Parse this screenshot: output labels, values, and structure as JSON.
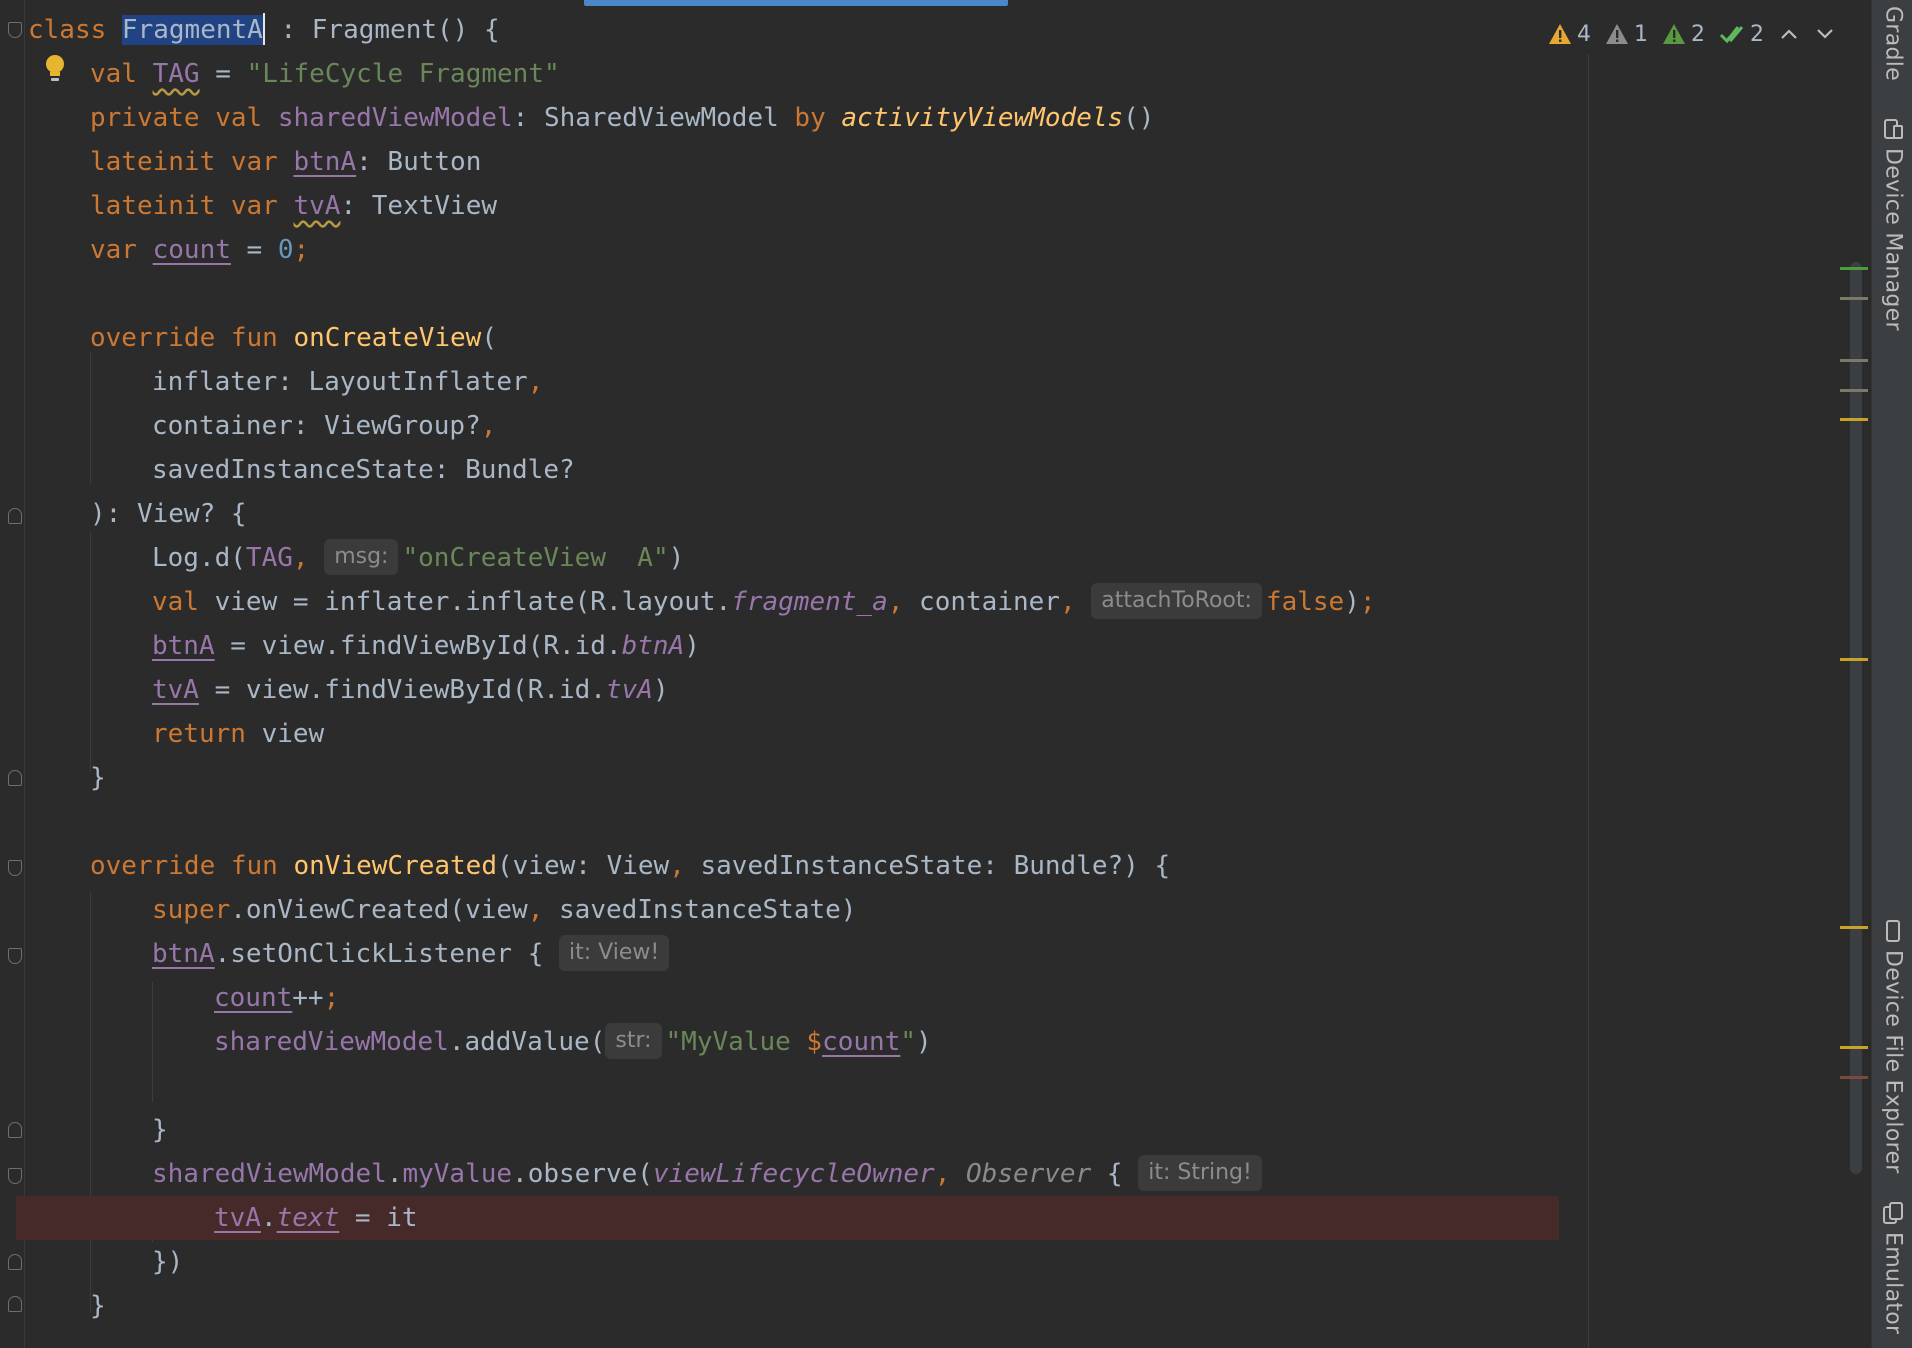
{
  "inspections": {
    "warnings": "4",
    "weak_warnings": "1",
    "typos": "2",
    "ok": "2",
    "colors": {
      "warning": "#e5a834",
      "weak": "#8c8c8c",
      "typo": "#5a9a3e",
      "ok": "#5fb85f"
    }
  },
  "code_lines": [
    [
      {
        "t": "class ",
        "c": "kw"
      },
      {
        "t": "FragmentA",
        "c": "selected"
      },
      {
        "caret": true
      },
      {
        "t": " : Fragment() {",
        "c": "plain"
      }
    ],
    [
      {
        "t": "val ",
        "c": "kw"
      },
      {
        "t": "TAG",
        "c": "warn-u"
      },
      {
        "t": " = ",
        "c": "plain"
      },
      {
        "t": "\"LifeCycle Fragment\"",
        "c": "str"
      }
    ],
    [
      {
        "t": "private val ",
        "c": "kw"
      },
      {
        "t": "sharedViewModel",
        "c": "prop"
      },
      {
        "t": ": SharedViewModel ",
        "c": "plain"
      },
      {
        "t": "by ",
        "c": "kw"
      },
      {
        "t": "activityViewModels",
        "c": "ext"
      },
      {
        "t": "()",
        "c": "plain"
      }
    ],
    [
      {
        "t": "lateinit var ",
        "c": "kw"
      },
      {
        "t": "btnA",
        "c": "prop-u"
      },
      {
        "t": ": Button",
        "c": "plain"
      }
    ],
    [
      {
        "t": "lateinit var ",
        "c": "kw"
      },
      {
        "t": "tvA",
        "c": "warn-u"
      },
      {
        "t": ": TextView",
        "c": "plain"
      }
    ],
    [
      {
        "t": "var ",
        "c": "kw"
      },
      {
        "t": "count",
        "c": "prop-u"
      },
      {
        "t": " = ",
        "c": "plain"
      },
      {
        "t": "0",
        "c": "num"
      },
      {
        "t": ";",
        "c": "kw"
      }
    ],
    [],
    [
      {
        "t": "override fun ",
        "c": "kw"
      },
      {
        "t": "onCreateView",
        "c": "fn"
      },
      {
        "t": "(",
        "c": "plain"
      }
    ],
    [
      {
        "t": "inflater: LayoutInflater",
        "c": "plain"
      },
      {
        "t": ",",
        "c": "kw"
      }
    ],
    [
      {
        "t": "container: ViewGroup?",
        "c": "plain"
      },
      {
        "t": ",",
        "c": "kw"
      }
    ],
    [
      {
        "t": "savedInstanceState: Bundle?",
        "c": "plain"
      }
    ],
    [
      {
        "t": "): View? {",
        "c": "plain"
      }
    ],
    [
      {
        "t": "Log.d(",
        "c": "plain"
      },
      {
        "t": "TAG",
        "c": "prop"
      },
      {
        "t": ", ",
        "c": "kw"
      },
      {
        "hint": "msg:"
      },
      {
        "t": "\"onCreateView  A\"",
        "c": "str"
      },
      {
        "t": ")",
        "c": "plain"
      }
    ],
    [
      {
        "t": "val ",
        "c": "kw"
      },
      {
        "t": "view = inflater.inflate(R.layout.",
        "c": "plain"
      },
      {
        "t": "fragment_a",
        "c": "prop-it"
      },
      {
        "t": ", ",
        "c": "kw"
      },
      {
        "t": "container",
        "c": "plain"
      },
      {
        "t": ", ",
        "c": "kw"
      },
      {
        "hint": "attachToRoot:"
      },
      {
        "t": "false",
        "c": "kw"
      },
      {
        "t": ")",
        "c": "plain"
      },
      {
        "t": ";",
        "c": "kw"
      }
    ],
    [
      {
        "t": "btnA",
        "c": "prop-u"
      },
      {
        "t": " = view.findViewById(R.id.",
        "c": "plain"
      },
      {
        "t": "btnA",
        "c": "prop-it"
      },
      {
        "t": ")",
        "c": "plain"
      }
    ],
    [
      {
        "t": "tvA",
        "c": "prop-u"
      },
      {
        "t": " = view.findViewById(R.id.",
        "c": "plain"
      },
      {
        "t": "tvA",
        "c": "prop-it"
      },
      {
        "t": ")",
        "c": "plain"
      }
    ],
    [
      {
        "t": "return ",
        "c": "kw"
      },
      {
        "t": "view",
        "c": "plain"
      }
    ],
    [
      {
        "t": "}",
        "c": "plain"
      }
    ],
    [],
    [
      {
        "t": "override fun ",
        "c": "kw"
      },
      {
        "t": "onViewCreated",
        "c": "fn"
      },
      {
        "t": "(view: View",
        "c": "plain"
      },
      {
        "t": ", ",
        "c": "kw"
      },
      {
        "t": "savedInstanceState: Bundle?) {",
        "c": "plain"
      }
    ],
    [
      {
        "t": "super",
        "c": "kw"
      },
      {
        "t": ".onViewCreated(view",
        "c": "plain"
      },
      {
        "t": ", ",
        "c": "kw"
      },
      {
        "t": "savedInstanceState)",
        "c": "plain"
      }
    ],
    [
      {
        "t": "btnA",
        "c": "prop-u"
      },
      {
        "t": ".setOnClickListener { ",
        "c": "plain"
      },
      {
        "hint": "it: View!"
      }
    ],
    [
      {
        "t": "count",
        "c": "prop-u"
      },
      {
        "t": "++",
        "c": "plain"
      },
      {
        "t": ";",
        "c": "kw"
      }
    ],
    [
      {
        "t": "sharedViewModel",
        "c": "prop"
      },
      {
        "t": ".addValue(",
        "c": "plain"
      },
      {
        "hint": "str:"
      },
      {
        "t": "\"MyValue ",
        "c": "str"
      },
      {
        "t": "$",
        "c": "kw"
      },
      {
        "t": "count",
        "c": "prop-u"
      },
      {
        "t": "\"",
        "c": "str"
      },
      {
        "t": ")",
        "c": "plain"
      }
    ],
    [],
    [
      {
        "t": "}",
        "c": "plain"
      }
    ],
    [
      {
        "t": "sharedViewModel",
        "c": "prop"
      },
      {
        "t": ".",
        "c": "plain"
      },
      {
        "t": "myValue",
        "c": "prop"
      },
      {
        "t": ".observe(",
        "c": "plain"
      },
      {
        "t": "viewLifecycleOwner",
        "c": "prop-it"
      },
      {
        "t": ", ",
        "c": "kw"
      },
      {
        "t": "Observer",
        "c": "italic-dim"
      },
      {
        "t": " { ",
        "c": "plain"
      },
      {
        "hint": "it: String!"
      }
    ],
    [
      {
        "t": "tvA",
        "c": "prop-u"
      },
      {
        "t": ".",
        "c": "plain"
      },
      {
        "t": "text",
        "c": "prop-it-u"
      },
      {
        "t": " = it",
        "c": "plain"
      }
    ],
    [
      {
        "t": "})",
        "c": "plain"
      }
    ],
    [
      {
        "t": "}",
        "c": "plain"
      }
    ]
  ],
  "tool_window_tabs": {
    "gradle": "Gradle",
    "device_manager": "Device Manager",
    "device_file_explorer": "Device File Explorer",
    "emulator": "Emulator"
  }
}
